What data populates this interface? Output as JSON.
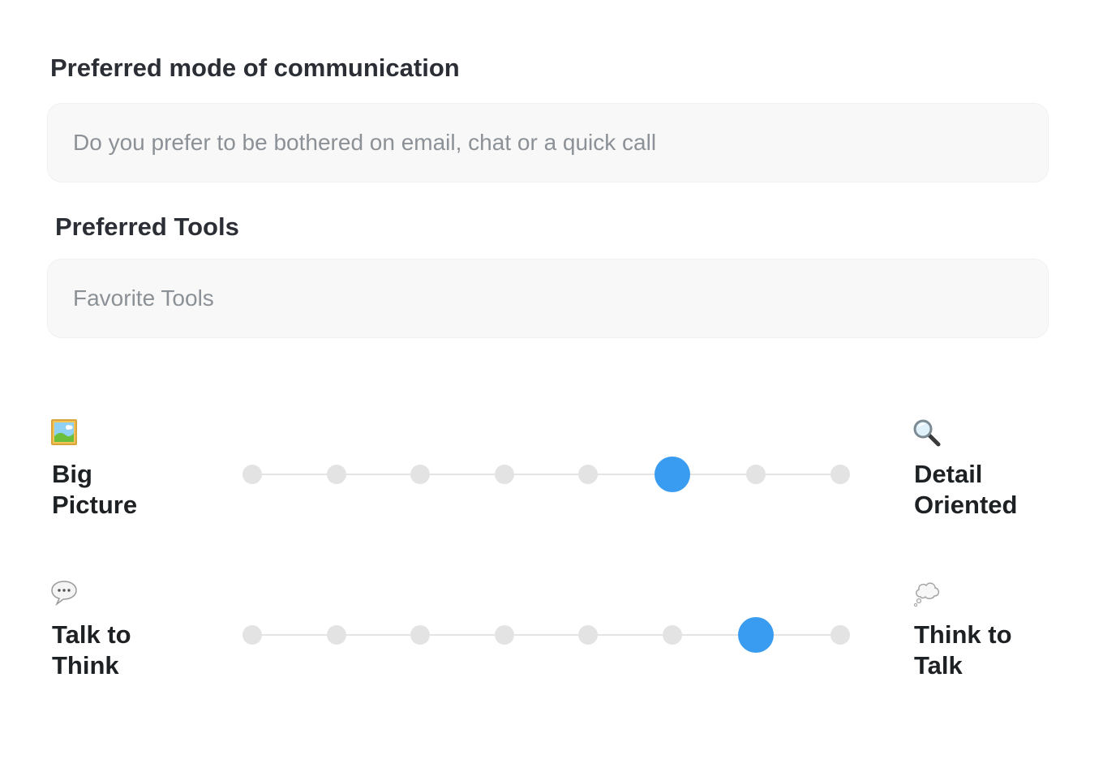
{
  "communication": {
    "label": "Preferred mode of communication",
    "placeholder": "Do you prefer to be bothered on email, chat or a quick call",
    "value": ""
  },
  "tools": {
    "label": "Preferred Tools",
    "placeholder": "Favorite Tools",
    "value": ""
  },
  "scales": [
    {
      "left_icon": "framed-picture-icon",
      "left_label": "Big\nPicture",
      "right_icon": "magnifying-glass-icon",
      "right_label": "Detail\nOriented",
      "steps": 8,
      "selected_index": 5
    },
    {
      "left_icon": "speech-bubble-icon",
      "left_label": "Talk to\nThink",
      "right_icon": "thought-bubble-icon",
      "right_label": "Think to\nTalk",
      "steps": 8,
      "selected_index": 6
    }
  ],
  "colors": {
    "selected_dot": "#3a9cf0",
    "unselected_dot": "#e3e3e3",
    "input_background": "#f8f8f8"
  }
}
